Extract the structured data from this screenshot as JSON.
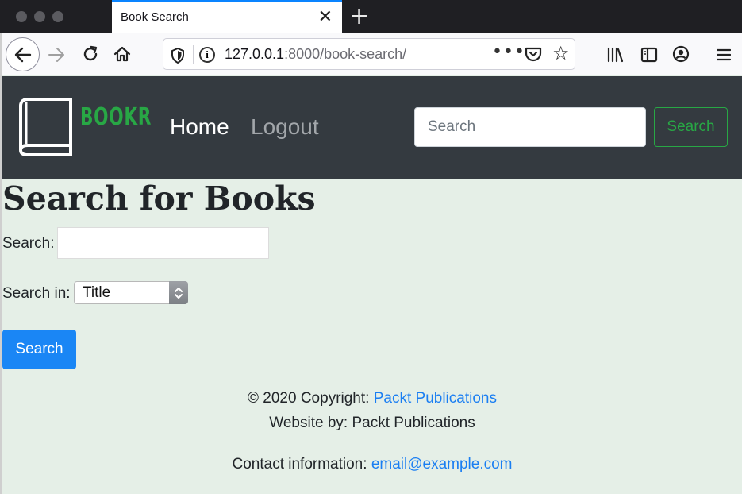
{
  "browser": {
    "tab_title": "Book Search",
    "tab_close_icon": "close-icon",
    "new_tab_icon": "plus-icon",
    "url_host": "127.0.0.1",
    "url_path": ":8000/book-search/",
    "more_label": "•••"
  },
  "site": {
    "brand": "BOOKR",
    "nav_home": "Home",
    "nav_logout": "Logout",
    "search_placeholder": "Search",
    "search_button": "Search",
    "brand_color": "#28a745"
  },
  "page": {
    "title": "Search for Books",
    "search_label": "Search:",
    "search_value": "",
    "search_in_label": "Search in:",
    "search_in_selected": "Title",
    "submit_label": "Search"
  },
  "footer": {
    "copyright": "© 2020 Copyright: ",
    "copyright_link": "Packt Publications",
    "website_by": "Website by: Packt Publications",
    "contact_label": "Contact information: ",
    "contact_email": "email@example.com"
  }
}
